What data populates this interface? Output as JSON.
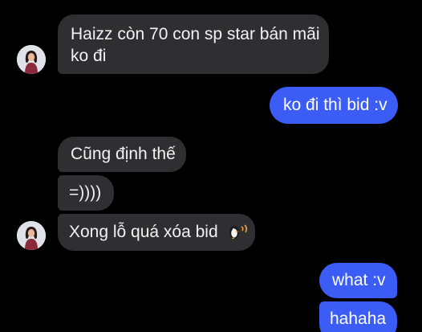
{
  "conversation": {
    "messages": [
      {
        "side": "incoming",
        "line1": "Haizz còn 70 con sp star bán mãi",
        "line2": "ko đi"
      },
      {
        "side": "outgoing",
        "text": "ko đi thì bid :v"
      },
      {
        "side": "incoming",
        "text": "Cũng định thế"
      },
      {
        "side": "incoming",
        "text": "=))))"
      },
      {
        "side": "incoming",
        "text": "Xong lỗ quá xóa bid",
        "emoji_icon": "penguin-sticker-icon"
      },
      {
        "side": "outgoing",
        "text": "what :v"
      },
      {
        "side": "outgoing",
        "text": "hahaha"
      }
    ]
  },
  "colors": {
    "background": "#000000",
    "incoming_bubble": "#2f2f31",
    "outgoing_bubble": "#3b5cf5",
    "text": "#f2f2f2"
  }
}
